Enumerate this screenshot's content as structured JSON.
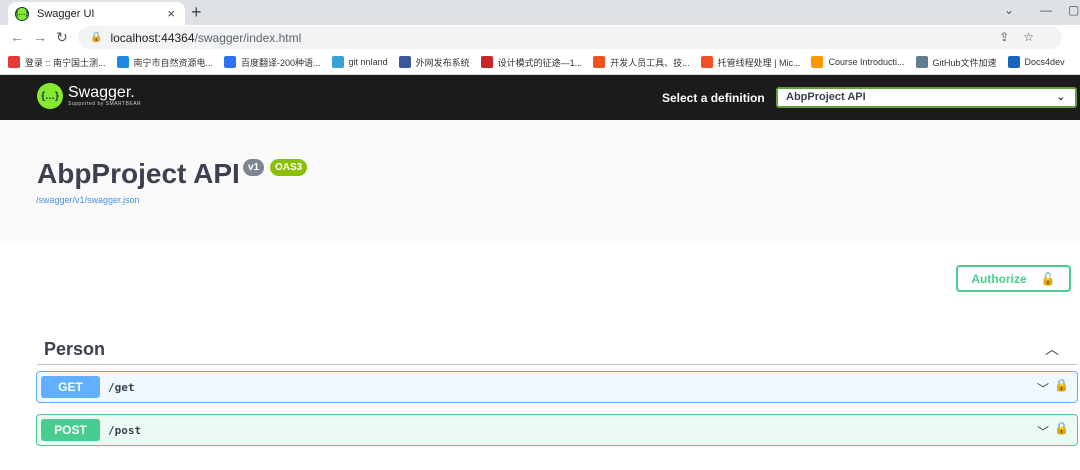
{
  "browser": {
    "tab_title": "Swagger UI",
    "tab_close": "×",
    "new_tab": "+",
    "url_host": "localhost:44364",
    "url_path": "/swagger/index.html",
    "bookmarks": [
      {
        "label": "登录 :: 南宁国土测...",
        "color": "#e53935"
      },
      {
        "label": "南宁市自然资源电...",
        "color": "#1e88e5"
      },
      {
        "label": "百度翻译-200种语...",
        "color": "#2b72f5"
      },
      {
        "label": "git nnland",
        "color": "#3aa0d8"
      },
      {
        "label": "外网发布系统",
        "color": "#3b5998"
      },
      {
        "label": "设计模式的征途—1...",
        "color": "#c62828"
      },
      {
        "label": "开发人员工具、技...",
        "color": "#f25022"
      },
      {
        "label": "托管线程处理 | Mic...",
        "color": "#f25022"
      },
      {
        "label": "Course Introducti...",
        "color": "#ff9800"
      },
      {
        "label": "GitHub文件加速",
        "color": "#607d8b"
      },
      {
        "label": "Docs4dev",
        "color": "#1565c0"
      }
    ]
  },
  "swagger": {
    "brand": "Swagger.",
    "brand_sub": "Supported by SMARTBEAR",
    "select_label": "Select a definition",
    "selected_definition": "AbpProject API"
  },
  "info": {
    "title": "AbpProject API",
    "version_badge": "v1",
    "oas_badge": "OAS3",
    "spec_url": "/swagger/v1/swagger.json"
  },
  "authorize": {
    "label": "Authorize"
  },
  "tag": {
    "name": "Person"
  },
  "operations": [
    {
      "method": "GET",
      "path": "/get"
    },
    {
      "method": "POST",
      "path": "/post"
    }
  ]
}
